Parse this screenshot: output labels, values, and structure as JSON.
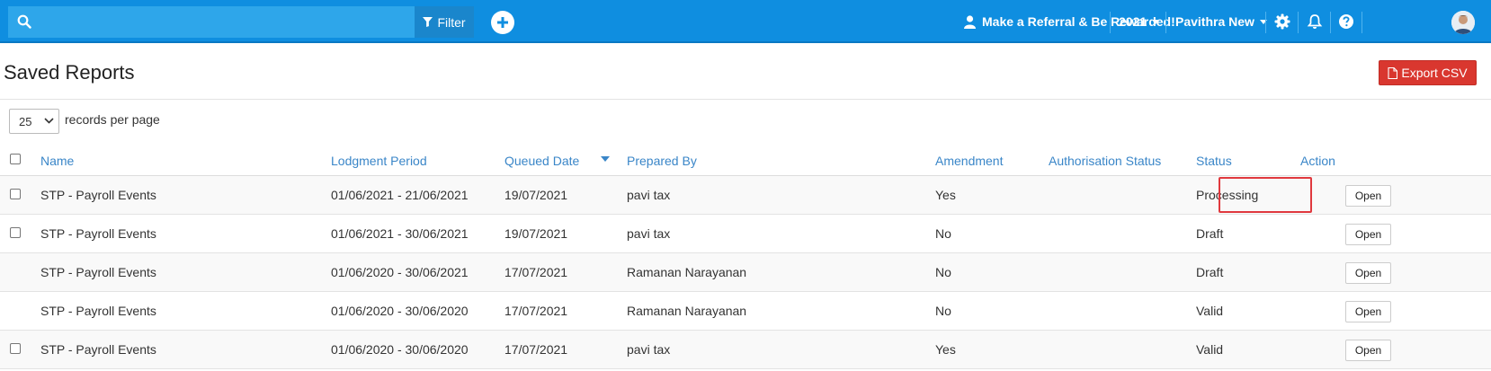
{
  "topbar": {
    "search_placeholder": "",
    "filter_label": "Filter",
    "referral_label": "Make a Referral & Be Rewarded!",
    "year_label": "2021",
    "user_label": "Pavithra New"
  },
  "header": {
    "title": "Saved Reports",
    "export_label": "Export CSV"
  },
  "pagination": {
    "per_page_value": "25",
    "per_page_label": "records per page"
  },
  "table": {
    "columns": {
      "name": "Name",
      "lodgment": "Lodgment Period",
      "queued": "Queued Date",
      "prepared": "Prepared By",
      "amendment": "Amendment",
      "authorisation": "Authorisation Status",
      "status": "Status",
      "action": "Action"
    },
    "rows": [
      {
        "name": "STP - Payroll Events",
        "lodgment": "01/06/2021 - 21/06/2021",
        "queued": "19/07/2021",
        "prepared": "pavi tax",
        "amendment": "Yes",
        "authorisation": "",
        "status": "Processing",
        "action": "Open"
      },
      {
        "name": "STP - Payroll Events",
        "lodgment": "01/06/2021 - 30/06/2021",
        "queued": "19/07/2021",
        "prepared": "pavi tax",
        "amendment": "No",
        "authorisation": "",
        "status": "Draft",
        "action": "Open"
      },
      {
        "name": "STP - Payroll Events",
        "lodgment": "01/06/2020 - 30/06/2021",
        "queued": "17/07/2021",
        "prepared": "Ramanan Narayanan",
        "amendment": "No",
        "authorisation": "",
        "status": "Draft",
        "action": "Open"
      },
      {
        "name": "STP - Payroll Events",
        "lodgment": "01/06/2020 - 30/06/2020",
        "queued": "17/07/2021",
        "prepared": "Ramanan Narayanan",
        "amendment": "No",
        "authorisation": "",
        "status": "Valid",
        "action": "Open"
      },
      {
        "name": "STP - Payroll Events",
        "lodgment": "01/06/2020 - 30/06/2020",
        "queued": "17/07/2021",
        "prepared": "pavi tax",
        "amendment": "Yes",
        "authorisation": "",
        "status": "Valid",
        "action": "Open"
      }
    ]
  },
  "colors": {
    "topbar": "#0f8ee0",
    "link": "#3a86c8",
    "export": "#d9372f",
    "highlight": "#e0393e"
  },
  "icons": [
    "search-icon",
    "filter-icon",
    "plus-circle-icon",
    "user-icon",
    "caret-down-icon",
    "gear-icon",
    "bell-icon",
    "question-icon",
    "avatar",
    "file-icon",
    "sort-desc-icon"
  ]
}
